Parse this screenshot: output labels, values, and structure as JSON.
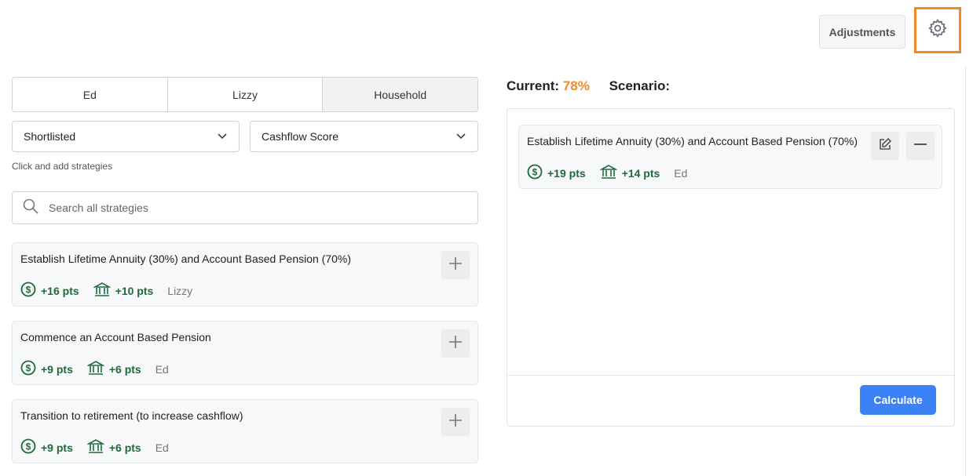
{
  "header": {
    "adjustments_label": "Adjustments",
    "settings_icon": "gear-icon"
  },
  "tabs": [
    {
      "label": "Ed"
    },
    {
      "label": "Lizzy"
    },
    {
      "label": "Household",
      "active": true
    }
  ],
  "filters": {
    "list_select": "Shortlisted",
    "sort_select": "Cashflow Score",
    "hint": "Click and add strategies"
  },
  "search": {
    "placeholder": "Search all strategies",
    "value": ""
  },
  "strategies": [
    {
      "title": "Establish Lifetime Annuity (30%) and Account Based Pension (70%)",
      "cash_pts": "+16 pts",
      "bank_pts": "+10 pts",
      "owner": "Lizzy"
    },
    {
      "title": "Commence an Account Based Pension",
      "cash_pts": "+9 pts",
      "bank_pts": "+6 pts",
      "owner": "Ed"
    },
    {
      "title": "Transition to retirement (to increase cashflow)",
      "cash_pts": "+9 pts",
      "bank_pts": "+6 pts",
      "owner": "Ed"
    }
  ],
  "scenario": {
    "current_label": "Current:",
    "current_value": "78%",
    "scenario_label": "Scenario:",
    "items": [
      {
        "title": "Establish Lifetime Annuity (30%) and Account Based Pension (70%)",
        "cash_pts": "+19 pts",
        "bank_pts": "+14 pts",
        "owner": "Ed"
      }
    ],
    "calculate_label": "Calculate"
  },
  "colors": {
    "accent_orange": "#f08a24",
    "points_green": "#1e6a3a",
    "primary_blue": "#3b82f6"
  }
}
